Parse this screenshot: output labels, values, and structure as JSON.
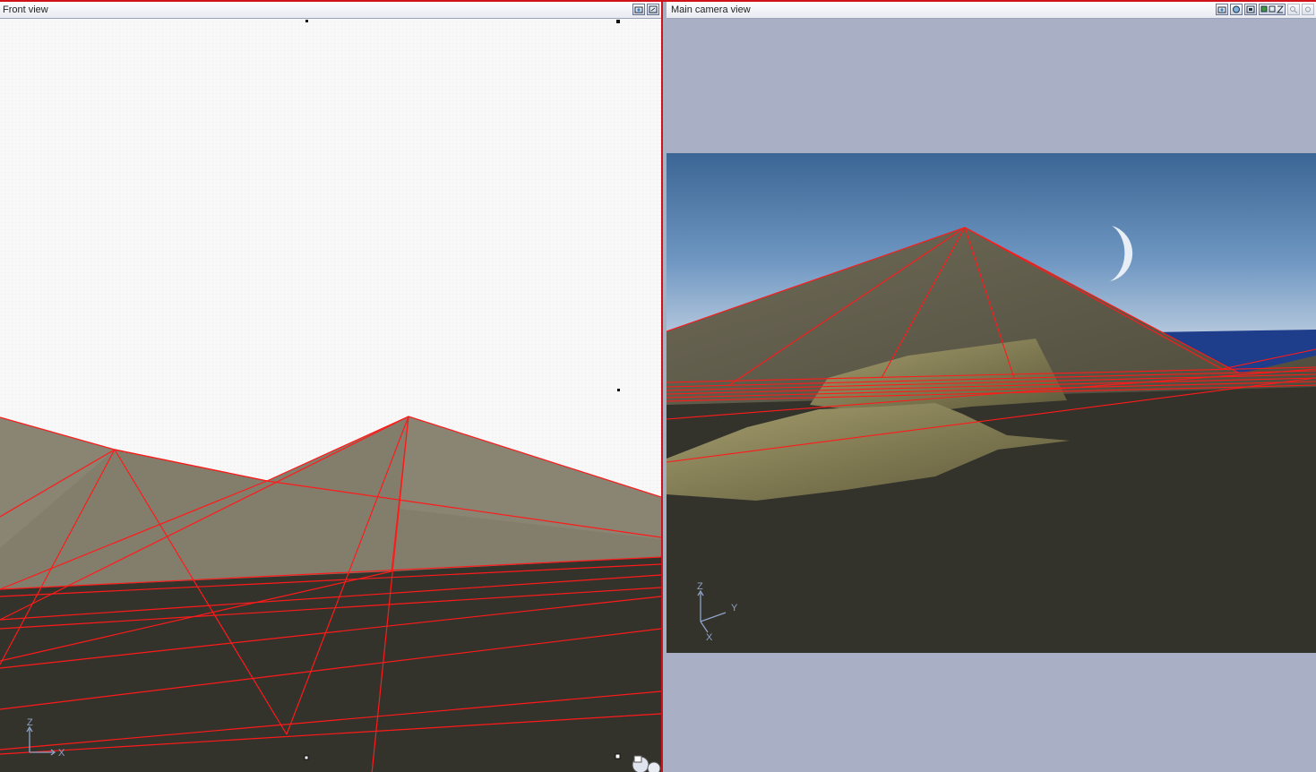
{
  "front_view": {
    "title": "Front view",
    "toolbar": [
      {
        "name": "camera-view-icon"
      },
      {
        "name": "maximize-view-icon"
      }
    ],
    "axis": {
      "x_label": "X",
      "z_label": "Z"
    }
  },
  "camera_view": {
    "title": "Main camera view",
    "toolbar": [
      {
        "name": "camera-view-icon"
      },
      {
        "name": "render-preview-icon"
      },
      {
        "name": "frame-icon"
      },
      {
        "name": "display-mode-icon"
      },
      {
        "name": "zoom-icon",
        "disabled": true
      },
      {
        "name": "options-icon",
        "disabled": true
      }
    ],
    "axis": {
      "y_label": "Y",
      "z_label": "Z",
      "x_label": "X"
    }
  },
  "colors": {
    "wireframe": "#ff1a1a",
    "terrain_front": "#8a8473",
    "ground_dark": "#33332c",
    "sky_top": "#3f6a99",
    "sky_bottom": "#b9c8dc",
    "sea": "#1e3d8a",
    "letterbox": "#a9b0c6",
    "paper": "#f7f7f7"
  }
}
